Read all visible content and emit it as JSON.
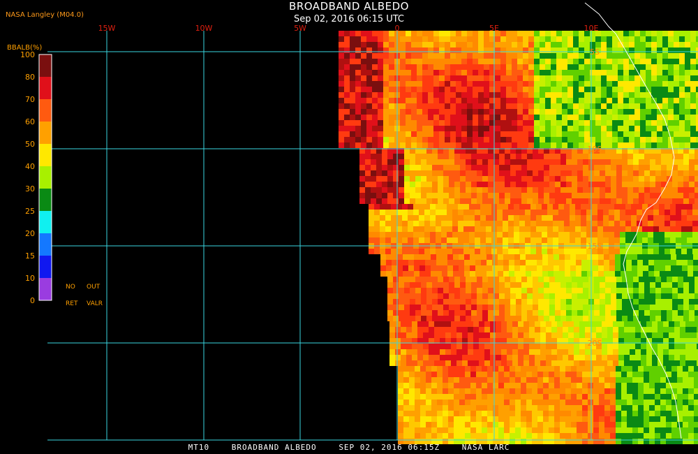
{
  "header": {
    "title": "BROADBAND ALBEDO",
    "subtitle": "Sep 02, 2016 06:15 UTC",
    "producer": "NASA Langley (M04.0)"
  },
  "grid": {
    "lon_labels": [
      "15W",
      "10W",
      "5W",
      "0",
      "5E",
      "10E"
    ],
    "lat_labels": [
      "5S",
      "10S",
      "15S",
      "20S"
    ]
  },
  "legend": {
    "title": "BBALB(%)",
    "ticks": [
      "100",
      "80",
      "70",
      "60",
      "50",
      "40",
      "30",
      "25",
      "20",
      "15",
      "10",
      "0"
    ],
    "colors": [
      "#7a0f0f",
      "#e0101a",
      "#ff5a10",
      "#ffa000",
      "#ffe800",
      "#a8f000",
      "#0a8a14",
      "#10f0f0",
      "#1478ff",
      "#1018f0",
      "#9a3ce0"
    ],
    "no_ret_label_1": "NO",
    "no_ret_label_2": "RET",
    "out_valr_label_1": "OUT",
    "out_valr_label_2": "VALR",
    "label_color": "#ffa000"
  },
  "footer": {
    "satellite": "MT10",
    "product": "BROADBAND ALBEDO",
    "datetime": "SEP 02, 2016 06:15Z",
    "source": "NASA LARC"
  },
  "colors": {
    "grid": "#3ad6e0",
    "lon_label": "#e02010",
    "lat_label": "#ff8a10",
    "coast": "#ffffff"
  }
}
